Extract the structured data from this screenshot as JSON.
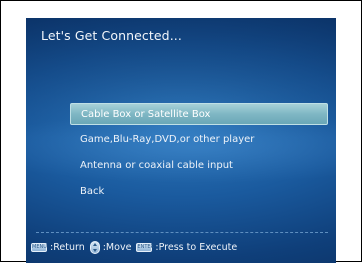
{
  "title": "Let's Get Connected...",
  "menu": {
    "items": [
      {
        "label": "Cable Box or Satellite Box",
        "selected": true
      },
      {
        "label": "Game,Blu-Ray,DVD,or other player",
        "selected": false
      },
      {
        "label": "Antenna or coaxial cable input",
        "selected": false
      },
      {
        "label": "Back",
        "selected": false
      }
    ]
  },
  "footer": {
    "menu_key_glyph": "MENU",
    "return_label": ":Return",
    "move_label": ":Move",
    "enter_key_glyph": "ENTER",
    "execute_label": ":Press to Execute"
  },
  "colors": {
    "background": "#1a5a9e",
    "highlight": "#7fb7c4",
    "text": "#eef3f9"
  }
}
